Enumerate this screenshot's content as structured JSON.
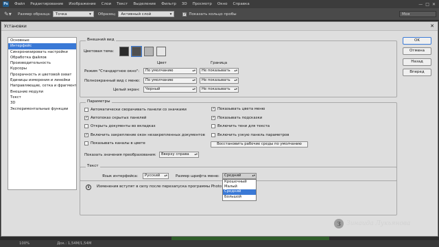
{
  "menubar": {
    "logo": "Ps",
    "items": [
      "Файл",
      "Редактирование",
      "Изображение",
      "Слои",
      "Текст",
      "Выделение",
      "Фильтр",
      "3D",
      "Просмотр",
      "Окно",
      "Справка"
    ],
    "win_min": "—",
    "win_max": "□",
    "win_close": "✕"
  },
  "options_bar": {
    "size_label": "Размер образца:",
    "size_value": "Точка",
    "sample_label": "Образец:",
    "sample_value": "Активный слой",
    "ring_label": "Показать кольцо пробы",
    "ring_checked": "✓",
    "workspace": "Моя"
  },
  "dialog": {
    "title": "Установки",
    "close": "✕",
    "sidebar": [
      "Основные",
      "Интерфейс",
      "Синхронизировать настройки",
      "Обработка файлов",
      "Производительность",
      "Курсоры",
      "Прозрачность и цветовой охват",
      "Единицы измерения и линейки",
      "Направляющие, сетка и фрагменты",
      "Внешние модули",
      "Текст",
      "3D",
      "Экспериментальные функции"
    ],
    "buttons": {
      "ok": "OK",
      "cancel": "Отмена",
      "back": "Назад",
      "next": "Вперед"
    },
    "appearance": {
      "title": "Внешний вид",
      "color_theme_label": "Цветовая тема:",
      "col_color": "Цвет",
      "col_border": "Граница",
      "std_label": "Режим \"Стандартное окно\":",
      "std_color": "По умолчанию",
      "std_border": "Не показывать",
      "full_menu_label": "Полноэкранный вид с меню:",
      "full_menu_color": "По умолчанию",
      "full_menu_border": "Не показывать",
      "full_label": "Целый экран:",
      "full_color": "Черный",
      "full_border": "Не показывать",
      "swatches": [
        "#2b2b2b",
        "#4f4f4f",
        "#b5b5b5",
        "#e6e6e6"
      ]
    },
    "params": {
      "title": "Параметры",
      "left": [
        {
          "label": "Автоматически сворачивать панели со значками",
          "checked": ""
        },
        {
          "label": "Автопоказ скрытых панелей",
          "checked": "✓"
        },
        {
          "label": "Открыть документы во вкладках",
          "checked": ""
        },
        {
          "label": "Включить закрепление окон незакрепленных документов",
          "checked": "✓"
        },
        {
          "label": "Показывать каналы в цвете",
          "checked": ""
        }
      ],
      "right": [
        {
          "label": "Показывать цвета меню",
          "checked": "✓"
        },
        {
          "label": "Показывать подсказки",
          "checked": "✓"
        },
        {
          "label": "Включить тени для текста",
          "checked": ""
        },
        {
          "label": "Включить узкую панель параметров",
          "checked": ""
        }
      ],
      "restore_button": "Восстановить рабочие среды по умолчанию",
      "transform_label": "Показать значения преобразования:",
      "transform_value": "Вверху справа"
    },
    "text": {
      "title": "Текст",
      "lang_label": "Язык интерфейса:",
      "lang_value": "Русский",
      "size_label": "Размер шрифта меню:",
      "size_value": "Средний",
      "info": "i",
      "notice": "Изменения вступят в силу после перезапуска программы Photo",
      "size_options": [
        {
          "label": "Крошечный",
          "selected": false
        },
        {
          "label": "Малый",
          "selected": false
        },
        {
          "label": "Средний",
          "selected": true
        },
        {
          "label": "Большой",
          "selected": false
        }
      ]
    }
  },
  "watermark": {
    "logo": "З",
    "text": "Зинаида Лукьянова"
  },
  "statusbar": {
    "zoom": "100%",
    "doc": "Док.: 1,54M/1,54M"
  }
}
